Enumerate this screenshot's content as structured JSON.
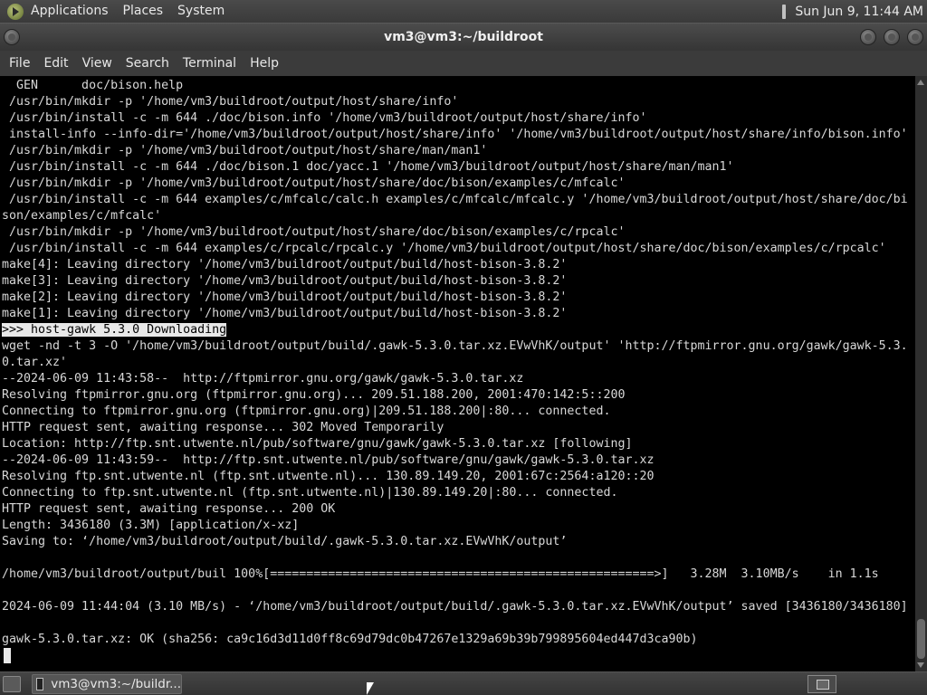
{
  "top_panel": {
    "menus": [
      "Applications",
      "Places",
      "System"
    ],
    "clock": "Sun Jun  9, 11:44 AM"
  },
  "window": {
    "title": "vm3@vm3:~/buildroot"
  },
  "menubar": {
    "items": [
      "File",
      "Edit",
      "View",
      "Search",
      "Terminal",
      "Help"
    ]
  },
  "terminal": {
    "lines": [
      "  GEN      doc/bison.help",
      " /usr/bin/mkdir -p '/home/vm3/buildroot/output/host/share/info'",
      " /usr/bin/install -c -m 644 ./doc/bison.info '/home/vm3/buildroot/output/host/share/info'",
      " install-info --info-dir='/home/vm3/buildroot/output/host/share/info' '/home/vm3/buildroot/output/host/share/info/bison.info'",
      " /usr/bin/mkdir -p '/home/vm3/buildroot/output/host/share/man/man1'",
      " /usr/bin/install -c -m 644 ./doc/bison.1 doc/yacc.1 '/home/vm3/buildroot/output/host/share/man/man1'",
      " /usr/bin/mkdir -p '/home/vm3/buildroot/output/host/share/doc/bison/examples/c/mfcalc'",
      " /usr/bin/install -c -m 644 examples/c/mfcalc/calc.h examples/c/mfcalc/mfcalc.y '/home/vm3/buildroot/output/host/share/doc/bi",
      "son/examples/c/mfcalc'",
      " /usr/bin/mkdir -p '/home/vm3/buildroot/output/host/share/doc/bison/examples/c/rpcalc'",
      " /usr/bin/install -c -m 644 examples/c/rpcalc/rpcalc.y '/home/vm3/buildroot/output/host/share/doc/bison/examples/c/rpcalc'",
      "make[4]: Leaving directory '/home/vm3/buildroot/output/build/host-bison-3.8.2'",
      "make[3]: Leaving directory '/home/vm3/buildroot/output/build/host-bison-3.8.2'",
      "make[2]: Leaving directory '/home/vm3/buildroot/output/build/host-bison-3.8.2'",
      "make[1]: Leaving directory '/home/vm3/buildroot/output/build/host-bison-3.8.2'",
      ">>> host-gawk 5.3.0 Downloading",
      "wget -nd -t 3 -O '/home/vm3/buildroot/output/build/.gawk-5.3.0.tar.xz.EVwVhK/output' 'http://ftpmirror.gnu.org/gawk/gawk-5.3.",
      "0.tar.xz'",
      "--2024-06-09 11:43:58--  http://ftpmirror.gnu.org/gawk/gawk-5.3.0.tar.xz",
      "Resolving ftpmirror.gnu.org (ftpmirror.gnu.org)... 209.51.188.200, 2001:470:142:5::200",
      "Connecting to ftpmirror.gnu.org (ftpmirror.gnu.org)|209.51.188.200|:80... connected.",
      "HTTP request sent, awaiting response... 302 Moved Temporarily",
      "Location: http://ftp.snt.utwente.nl/pub/software/gnu/gawk/gawk-5.3.0.tar.xz [following]",
      "--2024-06-09 11:43:59--  http://ftp.snt.utwente.nl/pub/software/gnu/gawk/gawk-5.3.0.tar.xz",
      "Resolving ftp.snt.utwente.nl (ftp.snt.utwente.nl)... 130.89.149.20, 2001:67c:2564:a120::20",
      "Connecting to ftp.snt.utwente.nl (ftp.snt.utwente.nl)|130.89.149.20|:80... connected.",
      "HTTP request sent, awaiting response... 200 OK",
      "Length: 3436180 (3.3M) [application/x-xz]",
      "Saving to: ‘/home/vm3/buildroot/output/build/.gawk-5.3.0.tar.xz.EVwVhK/output’",
      "",
      "/home/vm3/buildroot/output/buil 100%[=====================================================>]   3.28M  3.10MB/s    in 1.1s",
      "",
      "2024-06-09 11:44:04 (3.10 MB/s) - ‘/home/vm3/buildroot/output/build/.gawk-5.3.0.tar.xz.EVwVhK/output’ saved [3436180/3436180]",
      "",
      "gawk-5.3.0.tar.xz: OK (sha256: ca9c16d3d11d0ff8c69d79dc0b47267e1329a69b39b799895604ed447d3ca90b)"
    ],
    "highlighted_line_index": 15
  },
  "bottom_panel": {
    "task_label": "vm3@vm3:~/buildr..."
  }
}
